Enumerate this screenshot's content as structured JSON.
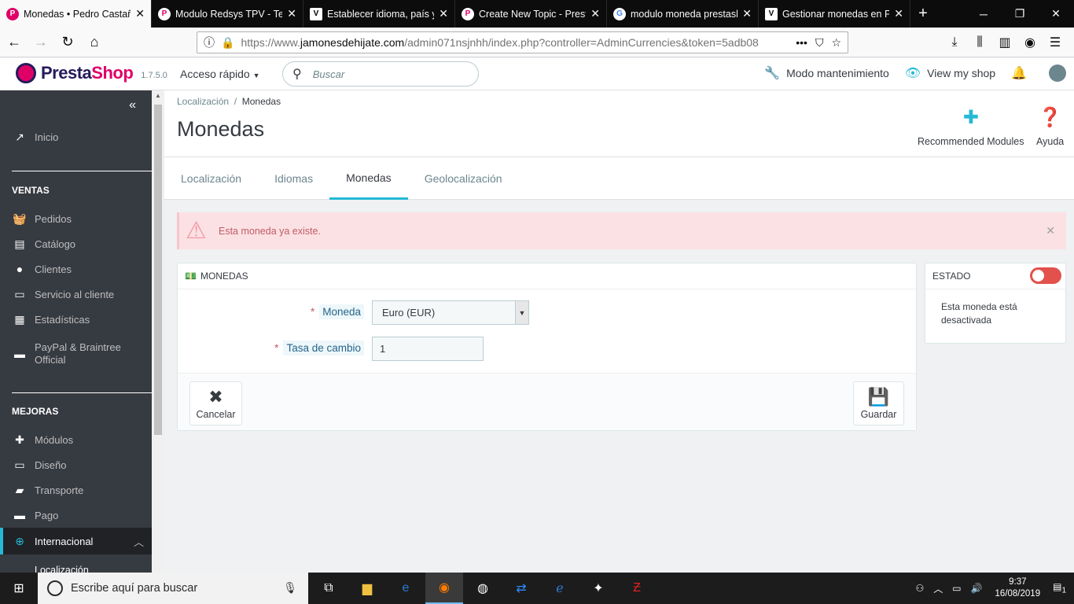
{
  "browser": {
    "tabs": [
      {
        "title": "Monedas • Pedro Castañ",
        "active": true,
        "icon": "prestashop-icon"
      },
      {
        "title": "Modulo Redsys TPV - Ter",
        "active": false,
        "icon": "prestashop-icon"
      },
      {
        "title": "Establecer idioma, país y",
        "active": false,
        "icon": "v-icon"
      },
      {
        "title": "Create New Topic - Prest",
        "active": false,
        "icon": "prestashop-icon"
      },
      {
        "title": "modulo moneda prestash",
        "active": false,
        "icon": "google-icon"
      },
      {
        "title": "Gestionar monedas en Pr",
        "active": false,
        "icon": "v-icon"
      }
    ],
    "url_prefix": "https://www.",
    "url_domain": "jamonesdehijate.com",
    "url_rest": "/admin071nsjnhh/index.php?controller=AdminCurrencies&token=5adb08"
  },
  "header": {
    "brand_a": "Presta",
    "brand_b": "Shop",
    "version": "1.7.5.0",
    "quick_access": "Acceso rápido",
    "search_placeholder": "Buscar",
    "maintenance": "Modo mantenimiento",
    "view_shop": "View my shop"
  },
  "sidebar": {
    "inicio": "Inicio",
    "ventas_title": "VENTAS",
    "ventas": [
      "Pedidos",
      "Catálogo",
      "Clientes",
      "Servicio al cliente",
      "Estadísticas",
      "PayPal & Braintree Official"
    ],
    "mejoras_title": "MEJORAS",
    "mejoras": [
      "Módulos",
      "Diseño",
      "Transporte",
      "Pago",
      "Internacional"
    ],
    "sub_item": "Localización"
  },
  "toolbar": {
    "breadcrumb_parent": "Localización",
    "breadcrumb_sep": "/",
    "breadcrumb_current": "Monedas",
    "title": "Monedas",
    "recommended": "Recommended Modules",
    "help": "Ayuda"
  },
  "tabs": [
    "Localización",
    "Idiomas",
    "Monedas",
    "Geolocalización"
  ],
  "alert": {
    "message": "Esta moneda ya existe."
  },
  "form": {
    "panel_title": "MONEDAS",
    "currency_label": "Moneda",
    "currency_value": "Euro (EUR)",
    "rate_label": "Tasa de cambio",
    "rate_value": "1",
    "cancel": "Cancelar",
    "save": "Guardar"
  },
  "status": {
    "title": "ESTADO",
    "enabled": false,
    "description": "Esta moneda está desactivada"
  },
  "taskbar": {
    "search_placeholder": "Escribe aquí para buscar",
    "time": "9:37",
    "date": "16/08/2019",
    "notifications": "1"
  },
  "colors": {
    "accent": "#25b9d7",
    "sidebar": "#363a41",
    "danger": "#e2514b"
  }
}
